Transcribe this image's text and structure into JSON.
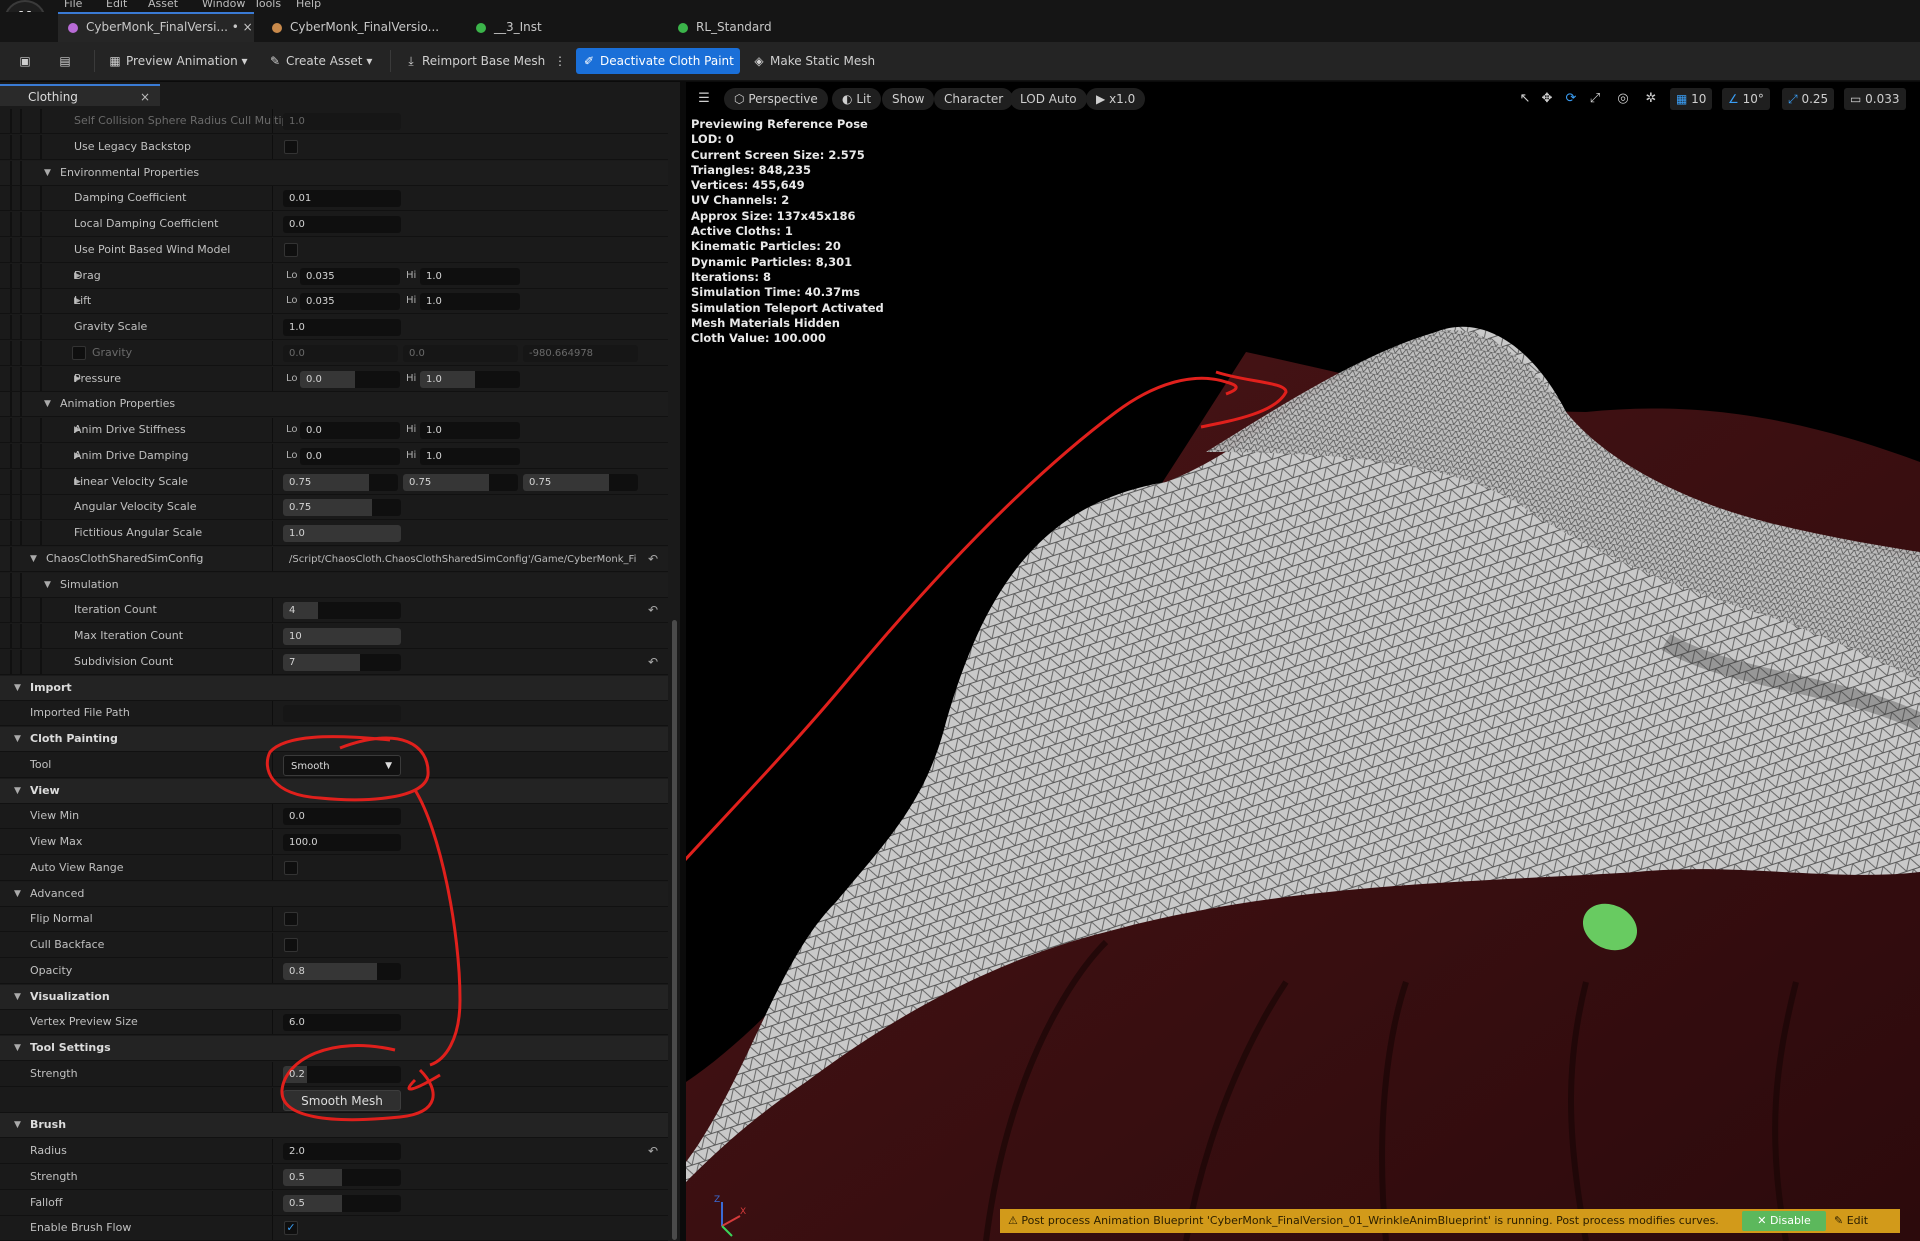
{
  "menu": {
    "items": [
      "File",
      "Edit",
      "Asset",
      "Window",
      "Tools",
      "Help"
    ]
  },
  "tabs": [
    {
      "label": "CyberMonk_FinalVersi...",
      "suffix": "• ×",
      "active": true,
      "dot": "#b86bd6"
    },
    {
      "label": "CyberMonk_FinalVersio...",
      "active": false,
      "dot": "#c98a4b"
    },
    {
      "label": "__3_Inst",
      "active": false,
      "dot": "#3bb44a"
    },
    {
      "label": "RL_Standard",
      "active": false,
      "dot": "#3bb44a"
    }
  ],
  "toolbar": {
    "preview_animation": "Preview Animation",
    "create_asset": "Create Asset",
    "reimport": "Reimport Base Mesh",
    "deactivate": "Deactivate Cloth Paint",
    "make_static": "Make Static Mesh"
  },
  "panel": {
    "tab_label": "Clothing",
    "close": "×",
    "rows": [
      {
        "label": "Self Collision Sphere Radius Cull Multip...",
        "indent": 4,
        "dim": true,
        "value": "1.0",
        "vdim": true
      },
      {
        "label": "Use Legacy Backstop",
        "indent": 4,
        "check": false
      },
      {
        "label": "Environmental Properties",
        "indent": 3,
        "section": true
      },
      {
        "label": "Damping Coefficient",
        "indent": 4,
        "value": "0.01"
      },
      {
        "label": "Local Damping Coefficient",
        "indent": 4,
        "value": "0.0"
      },
      {
        "label": "Use Point Based Wind Model",
        "indent": 4,
        "check": false
      },
      {
        "label": "Drag",
        "indent": 4,
        "expand": true,
        "lo": "0.035",
        "hi": "1.0"
      },
      {
        "label": "Lift",
        "indent": 4,
        "expand": true,
        "lo": "0.035",
        "hi": "1.0"
      },
      {
        "label": "Gravity Scale",
        "indent": 4,
        "value": "1.0"
      },
      {
        "label": "Gravity",
        "indent": 4,
        "expand": true,
        "dim": true,
        "gcheck": true,
        "vec": [
          "0.0",
          "0.0",
          "-980.664978"
        ],
        "vdim": true
      },
      {
        "label": "Pressure",
        "indent": 4,
        "expand": true,
        "lo": "0.0",
        "hi": "1.0",
        "lofill": 0.55,
        "hifill": 0.55
      },
      {
        "label": "Animation Properties",
        "indent": 3,
        "section": true
      },
      {
        "label": "Anim Drive Stiffness",
        "indent": 4,
        "expand": true,
        "lo": "0.0",
        "hi": "1.0"
      },
      {
        "label": "Anim Drive Damping",
        "indent": 4,
        "expand": true,
        "lo": "0.0",
        "hi": "1.0"
      },
      {
        "label": "Linear Velocity Scale",
        "indent": 4,
        "expand": true,
        "vec": [
          "0.75",
          "0.75",
          "0.75"
        ],
        "vfill": 0.75
      },
      {
        "label": "Angular Velocity Scale",
        "indent": 4,
        "value": "0.75",
        "fill": 0.75
      },
      {
        "label": "Fictitious Angular Scale",
        "indent": 4,
        "value": "1.0",
        "fill": 1.0
      },
      {
        "label": "ChaosClothSharedSimConfig",
        "indent": 2,
        "section": true,
        "path": "/Script/ChaosCloth.ChaosClothSharedSimConfig'/Game/CyberMonk_Fi",
        "reset": true
      },
      {
        "label": "Simulation",
        "indent": 3,
        "section": true
      },
      {
        "label": "Iteration Count",
        "indent": 4,
        "value": "4",
        "fill": 0.3,
        "reset": true
      },
      {
        "label": "Max Iteration Count",
        "indent": 4,
        "value": "10",
        "fill": 1.0
      },
      {
        "label": "Subdivision Count",
        "indent": 4,
        "value": "7",
        "fill": 0.65,
        "reset": true
      },
      {
        "label": "Import",
        "indent": 0,
        "category": true
      },
      {
        "label": "Imported File Path",
        "indent": 1,
        "value": "",
        "vdim": true
      },
      {
        "label": "Cloth Painting",
        "indent": 0,
        "category": true
      },
      {
        "label": "Tool",
        "indent": 1,
        "dropdown": "Smooth"
      },
      {
        "label": "View",
        "indent": 0,
        "category": true
      },
      {
        "label": "View Min",
        "indent": 1,
        "value": "0.0"
      },
      {
        "label": "View Max",
        "indent": 1,
        "value": "100.0"
      },
      {
        "label": "Auto View Range",
        "indent": 1,
        "check": false
      },
      {
        "label": "Advanced",
        "indent": 0,
        "section": true
      },
      {
        "label": "Flip Normal",
        "indent": 1,
        "check": false
      },
      {
        "label": "Cull Backface",
        "indent": 1,
        "check": false
      },
      {
        "label": "Opacity",
        "indent": 1,
        "value": "0.8",
        "fill": 0.8
      },
      {
        "label": "Visualization",
        "indent": 0,
        "category": true
      },
      {
        "label": "Vertex Preview Size",
        "indent": 1,
        "value": "6.0"
      },
      {
        "label": "Tool Settings",
        "indent": 0,
        "category": true
      },
      {
        "label": "Strength",
        "indent": 1,
        "value": "0.2",
        "fill": 0.2
      },
      {
        "label": "",
        "indent": 1,
        "button": "Smooth Mesh"
      },
      {
        "label": "Brush",
        "indent": 0,
        "category": true
      },
      {
        "label": "Radius",
        "indent": 1,
        "value": "2.0",
        "reset": true
      },
      {
        "label": "Strength",
        "indent": 1,
        "value": "0.5",
        "fill": 0.5
      },
      {
        "label": "Falloff",
        "indent": 1,
        "value": "0.5",
        "fill": 0.5
      },
      {
        "label": "Enable Brush Flow",
        "indent": 1,
        "check": true
      }
    ]
  },
  "viewport": {
    "perspective": "Perspective",
    "lit": "Lit",
    "show": "Show",
    "character": "Character",
    "lod": "LOD Auto",
    "speed": "x1.0",
    "grid_snap": "10",
    "angle_snap": "10°",
    "scale_snap": "0.25",
    "camera_speed": "0.033",
    "stats": [
      "Previewing Reference Pose",
      "LOD: 0",
      "Current Screen Size: 2.575",
      "Triangles: 848,235",
      "Vertices: 455,649",
      "UV Channels: 2",
      "Approx Size: 137x45x186",
      "Active Cloths: 1",
      "Kinematic Particles: 20",
      "Dynamic Particles: 8,301",
      "Iterations: 8",
      "Simulation Time: 40.37ms",
      "Simulation Teleport Activated",
      "Mesh Materials Hidden",
      "Cloth Value: 100.000"
    ],
    "axis_x": "X",
    "axis_z": "Z"
  },
  "warning": {
    "text": "⚠ Post process Animation Blueprint 'CyberMonk_FinalVersion_01_WrinkleAnimBlueprint' is running. Post process modifies curves.",
    "disable": "✕ Disable",
    "edit": "✎ Edit"
  },
  "colors": {
    "accent": "#1a6fd8",
    "annotation": "#e0201c",
    "paint": "#6ee06a"
  }
}
